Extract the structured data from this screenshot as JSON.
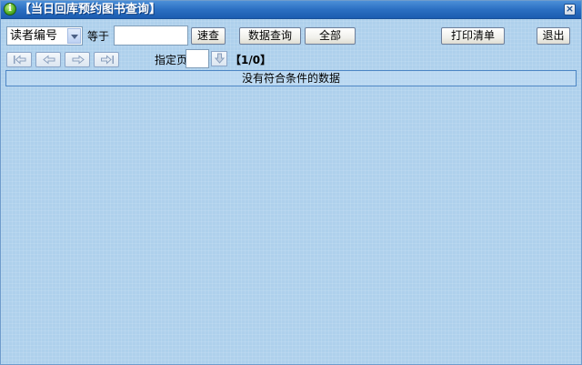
{
  "window": {
    "title": "【当日回库预约图书查询】",
    "app_icon_glyph": "i",
    "close_glyph": "×"
  },
  "search": {
    "field_select_value": "读者编号",
    "operator_label": "等于",
    "value": "",
    "quick_search_label": "速查"
  },
  "toolbar": {
    "data_query_label": "数据查询",
    "all_label": "全部",
    "print_list_label": "打印清单",
    "exit_label": "退出"
  },
  "pagination": {
    "first_icon": "first-page-icon",
    "prev_icon": "previous-page-icon",
    "next_icon": "next-page-icon",
    "last_icon": "last-page-icon",
    "goto_label": "指定页",
    "goto_value": "",
    "page_indicator": "【1/0】"
  },
  "results": {
    "empty_message": "没有符合条件的数据"
  },
  "colors": {
    "titlebar": "#2b6fc2",
    "background": "#aed0ec",
    "border": "#4d86c4"
  }
}
